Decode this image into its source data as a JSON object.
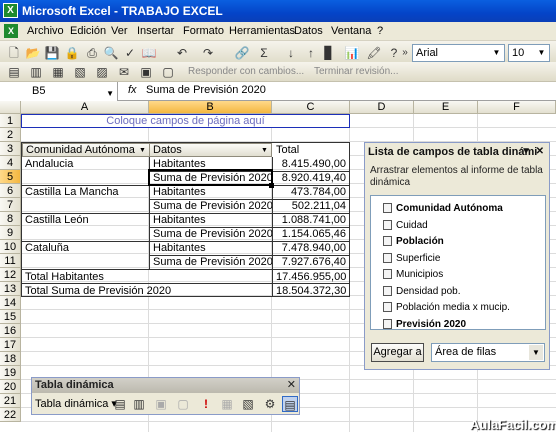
{
  "window": {
    "title": "Microsoft Excel - TRABAJO EXCEL"
  },
  "menu": [
    "Archivo",
    "Edición",
    "Ver",
    "Insertar",
    "Formato",
    "Herramientas",
    "Datos",
    "Ventana",
    "?"
  ],
  "toolbar": {
    "font_name": "Arial",
    "font_size": "10",
    "review_text": "Responder con cambios...",
    "end_review_text": "Terminar revisión..."
  },
  "formula_bar": {
    "cell_ref": "B5",
    "fx": "fx",
    "value": "Suma de Previsión 2020"
  },
  "columns": [
    "A",
    "B",
    "C",
    "D",
    "E",
    "F"
  ],
  "rows": [
    "1",
    "2",
    "3",
    "4",
    "5",
    "6",
    "7",
    "8",
    "9",
    "10",
    "11",
    "12",
    "13",
    "14",
    "15",
    "16",
    "17",
    "18",
    "19",
    "20",
    "21",
    "22"
  ],
  "sheet": {
    "page_fields_hint": "Coloque campos de página aquí",
    "header": {
      "a": "Comunidad Autónoma",
      "b": "Datos",
      "c": "Total"
    },
    "data_rows": [
      {
        "a": "Andalucia",
        "b": "Habitantes",
        "c": "8.415.490,00"
      },
      {
        "a": "",
        "b": "Suma de Previsión 2020",
        "c": "8.920.419,40"
      },
      {
        "a": "Castilla La Mancha",
        "b": "Habitantes",
        "c": "473.784,00"
      },
      {
        "a": "",
        "b": "Suma de Previsión 2020",
        "c": "502.211,04"
      },
      {
        "a": "Castilla León",
        "b": "Habitantes",
        "c": "1.088.741,00"
      },
      {
        "a": "",
        "b": "Suma de Previsión 2020",
        "c": "1.154.065,46"
      },
      {
        "a": "Cataluña",
        "b": "Habitantes",
        "c": "7.478.940,00"
      },
      {
        "a": "",
        "b": "Suma de Previsión 2020",
        "c": "7.927.676,40"
      }
    ],
    "total_habitantes": {
      "label": "Total Habitantes",
      "value": "17.456.955,00"
    },
    "total_prevision": {
      "label": "Total Suma de Previsión 2020",
      "value": "18.504.372,30"
    }
  },
  "field_list": {
    "title": "Lista de campos de tabla dinámi",
    "description": "Arrastrar elementos al informe de tabla dinámica",
    "fields": [
      {
        "label": "Comunidad Autónoma",
        "bold": true
      },
      {
        "label": "Cuidad",
        "bold": false
      },
      {
        "label": "Población",
        "bold": true
      },
      {
        "label": "Superficie",
        "bold": false
      },
      {
        "label": "Municipios",
        "bold": false
      },
      {
        "label": "Densidad pob.",
        "bold": false
      },
      {
        "label": "Población media x mucip.",
        "bold": false
      },
      {
        "label": "Previsión 2020",
        "bold": true
      }
    ],
    "add_button": "Agregar a",
    "area_select": "Área de filas"
  },
  "pivot_toolbar": {
    "title": "Tabla dinámica",
    "menu_label": "Tabla dinámica ▾"
  },
  "watermark": "AulaFacil.com"
}
